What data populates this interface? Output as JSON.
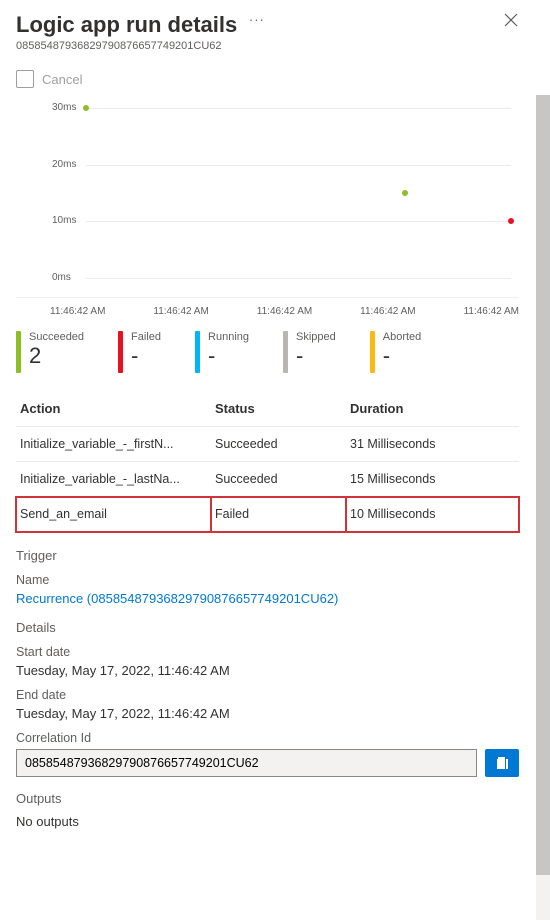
{
  "header": {
    "title": "Logic app run details",
    "run_id": "08585487936829790876657749201CU62"
  },
  "toolbar": {
    "cancel_label": "Cancel"
  },
  "chart_data": {
    "type": "scatter",
    "ylabel": "ms",
    "ylim": [
      0,
      30
    ],
    "yticks": [
      "0ms",
      "10ms",
      "20ms",
      "30ms"
    ],
    "xticks": [
      "11:46:42 AM",
      "11:46:42 AM",
      "11:46:42 AM",
      "11:46:42 AM",
      "11:46:42 AM"
    ],
    "series": [
      {
        "name": "Succeeded",
        "color": "#8cbf26",
        "points": [
          {
            "xi": 0,
            "y": 31
          },
          {
            "xi": 3,
            "y": 15
          }
        ]
      },
      {
        "name": "Failed",
        "color": "#e81123",
        "points": [
          {
            "xi": 4,
            "y": 10
          }
        ]
      }
    ]
  },
  "kpis": [
    {
      "label": "Succeeded",
      "value": "2",
      "color": "#8cbf26"
    },
    {
      "label": "Failed",
      "value": "-",
      "color": "#e81123"
    },
    {
      "label": "Running",
      "value": "-",
      "color": "#00b7f1"
    },
    {
      "label": "Skipped",
      "value": "-",
      "color": "#b8b6b3"
    },
    {
      "label": "Aborted",
      "value": "-",
      "color": "#fdb913"
    }
  ],
  "table": {
    "headers": {
      "action": "Action",
      "status": "Status",
      "duration": "Duration"
    },
    "rows": [
      {
        "action": "Initialize_variable_-_firstN...",
        "status": "Succeeded",
        "duration": "31 Milliseconds",
        "failed": false
      },
      {
        "action": "Initialize_variable_-_lastNa...",
        "status": "Succeeded",
        "duration": "15 Milliseconds",
        "failed": false
      },
      {
        "action": "Send_an_email",
        "status": "Failed",
        "duration": "10 Milliseconds",
        "failed": true
      }
    ]
  },
  "trigger": {
    "section": "Trigger",
    "name_label": "Name",
    "name_link": "Recurrence (08585487936829790876657749201CU62)"
  },
  "details": {
    "section": "Details",
    "start_label": "Start date",
    "start_value": "Tuesday, May 17, 2022, 11:46:42 AM",
    "end_label": "End date",
    "end_value": "Tuesday, May 17, 2022, 11:46:42 AM",
    "corr_label": "Correlation Id",
    "corr_value": "08585487936829790876657749201CU62"
  },
  "outputs": {
    "section": "Outputs",
    "value": "No outputs"
  }
}
